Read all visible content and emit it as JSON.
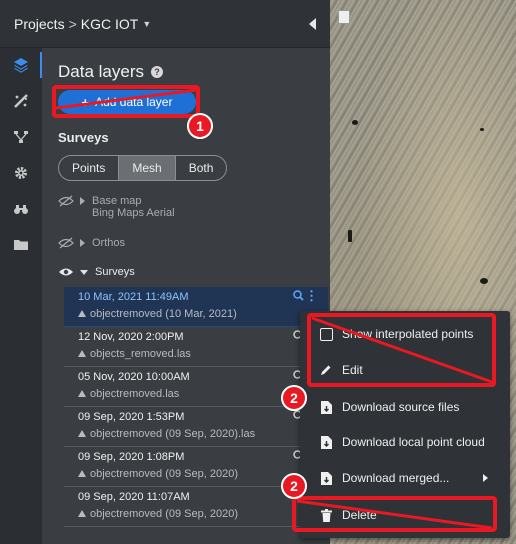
{
  "breadcrumb": {
    "root": "Projects",
    "sep": ">",
    "project": "KGC IOT"
  },
  "panel": {
    "title": "Data layers",
    "add_layer_label": "Add data layer",
    "surveys_label": "Surveys",
    "toggle": [
      "Points",
      "Mesh",
      "Both"
    ],
    "toggle_active": "Mesh"
  },
  "layers": {
    "base_map": {
      "title": "Base map",
      "subtitle": "Bing Maps Aerial"
    },
    "orthos": "Orthos",
    "surveys": "Surveys"
  },
  "surveys": [
    {
      "date": "10 Mar, 2021 11:49AM",
      "file": "objectremoved (10 Mar, 2021)",
      "selected": true
    },
    {
      "date": "12 Nov, 2020 2:00PM",
      "file": "objects_removed.las",
      "selected": false
    },
    {
      "date": "05 Nov, 2020 10:00AM",
      "file": "objectremoved.las",
      "selected": false
    },
    {
      "date": "09 Sep, 2020 1:53PM",
      "file": "objectremoved (09 Sep, 2020).las",
      "selected": false
    },
    {
      "date": "09 Sep, 2020 1:08PM",
      "file": "objectremoved (09 Sep, 2020)",
      "selected": false
    },
    {
      "date": "09 Sep, 2020 11:07AM",
      "file": "objectremoved (09 Sep, 2020)",
      "selected": false
    }
  ],
  "context_menu": {
    "show_interpolated": "Show interpolated points",
    "edit": "Edit",
    "download_source": "Download source files",
    "download_local": "Download local point cloud",
    "download_merged": "Download merged...",
    "delete": "Delete"
  },
  "annotations": {
    "badge_1": "1",
    "badge_2a": "2",
    "badge_2b": "2"
  },
  "colors": {
    "accent": "#1e6fd6",
    "highlight": "#e81923",
    "selected_row": "#1f3553"
  }
}
